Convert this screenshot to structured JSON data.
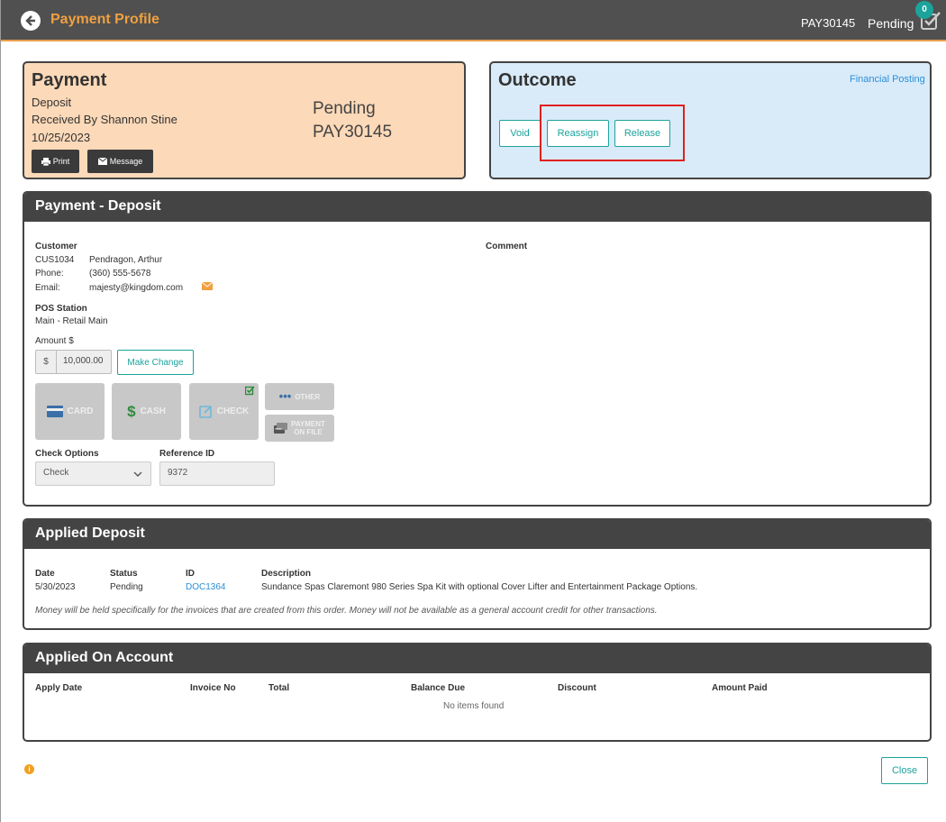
{
  "header": {
    "title": "Payment Profile",
    "payment_id": "PAY30145",
    "status": "Pending",
    "task_count": "0"
  },
  "payment_card": {
    "heading": "Payment",
    "type": "Deposit",
    "received_by": "Received By Shannon Stine",
    "date": "10/25/2023",
    "status": "Pending",
    "id": "PAY30145",
    "print_label": "Print",
    "message_label": "Message"
  },
  "outcome_card": {
    "heading": "Outcome",
    "financial_posting_link": "Financial Posting",
    "void_label": "Void",
    "reassign_label": "Reassign",
    "release_label": "Release"
  },
  "payment_deposit": {
    "heading": "Payment - Deposit",
    "customer_label": "Customer",
    "customer_id": "CUS1034",
    "customer_name": "Pendragon, Arthur",
    "phone_label": "Phone:",
    "phone": "(360) 555-5678",
    "email_label": "Email:",
    "email": "majesty@kingdom.com",
    "comment_label": "Comment",
    "pos_label": "POS Station",
    "pos_value": "Main - Retail Main",
    "amount_label": "Amount $",
    "amount_prefix": "$",
    "amount_value": "10,000.00",
    "make_change_label": "Make Change",
    "tiles": {
      "card": "CARD",
      "cash": "CASH",
      "check": "CHECK",
      "other": "OTHER",
      "payment_on_file_1": "PAYMENT",
      "payment_on_file_2": "ON FILE"
    },
    "check_options_label": "Check Options",
    "check_option_value": "Check",
    "reference_label": "Reference ID",
    "reference_value": "9372"
  },
  "applied_deposit": {
    "heading": "Applied Deposit",
    "columns": [
      "Date",
      "Status",
      "ID",
      "Description"
    ],
    "row": {
      "date": "5/30/2023",
      "status": "Pending",
      "id": "DOC1364",
      "description": "Sundance Spas Claremont 980 Series Spa Kit with optional Cover Lifter and Entertainment Package Options."
    },
    "note": "Money will be held specifically for the invoices that are created from this order. Money will not be available as a general account credit for other transactions."
  },
  "applied_on_account": {
    "heading": "Applied On Account",
    "columns": [
      "Apply Date",
      "Invoice No",
      "Total",
      "Balance Due",
      "Discount",
      "Amount Paid"
    ],
    "empty_text": "No items found"
  },
  "footer": {
    "close_label": "Close",
    "info_glyph": "i"
  },
  "colors": {
    "accent": "#1ba39c",
    "header_bg": "#505050",
    "title_orange": "#f0a040",
    "payment_bg": "#fcd9b8",
    "outcome_bg": "#d9ebf9",
    "highlight": "#e02020"
  }
}
